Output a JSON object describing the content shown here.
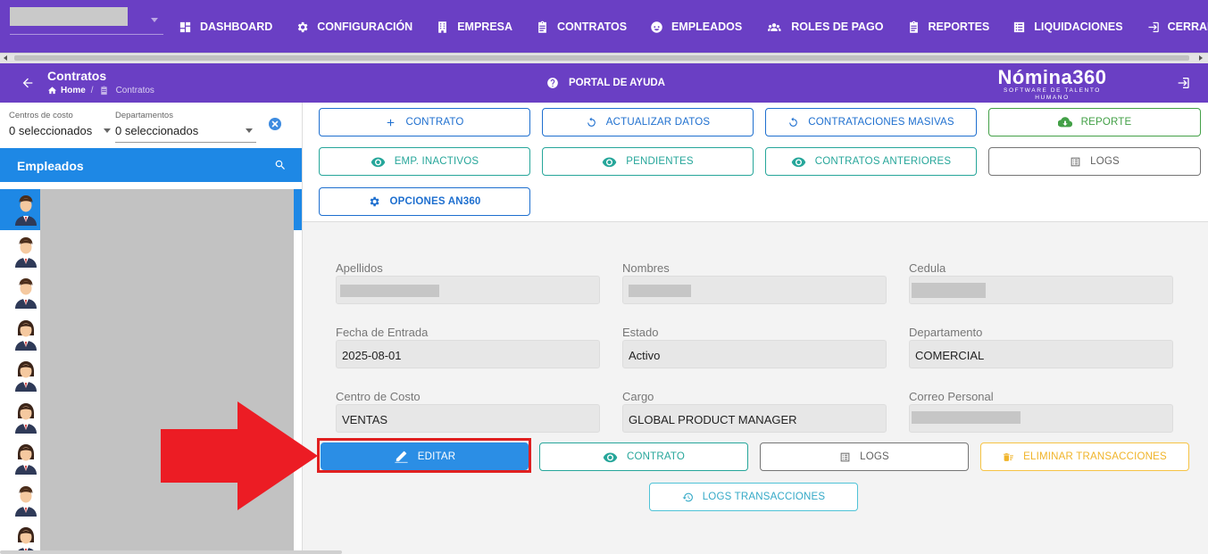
{
  "topnav": {
    "items": [
      {
        "label": "DASHBOARD",
        "icon": "dashboard-icon"
      },
      {
        "label": "CONFIGURACIÓN",
        "icon": "gear-icon"
      },
      {
        "label": "EMPRESA",
        "icon": "building-icon"
      },
      {
        "label": "CONTRATOS",
        "icon": "clipboard-icon"
      },
      {
        "label": "EMPLEADOS",
        "icon": "face-icon"
      },
      {
        "label": "ROLES DE PAGO",
        "icon": "users-icon"
      },
      {
        "label": "REPORTES",
        "icon": "clipboard-icon"
      },
      {
        "label": "LIQUIDACIONES",
        "icon": "list-icon"
      },
      {
        "label": "CERRAR SESIÓN",
        "icon": "logout-icon"
      }
    ]
  },
  "subheader": {
    "title": "Contratos",
    "breadcrumb_home": "Home",
    "breadcrumb_current": "Contratos",
    "help_label": "PORTAL DE AYUDA",
    "brand_main": "Nómina360",
    "brand_sub": "SOFTWARE DE TALENTO HUMANO"
  },
  "filters": {
    "cost_center_label": "Centros de costo",
    "cost_center_value": "0 seleccionados",
    "department_label": "Departamentos",
    "department_value": "0 seleccionados"
  },
  "employees": {
    "title": "Empleados",
    "avatars": [
      "male",
      "male",
      "male",
      "female",
      "female",
      "female",
      "female",
      "male",
      "female"
    ]
  },
  "toolbar": {
    "contrato": "CONTRATO",
    "actualizar": "ACTUALIZAR DATOS",
    "masivas": "CONTRATACIONES MASIVAS",
    "reporte": "REPORTE",
    "inactivos": "EMP. INACTIVOS",
    "pendientes": "PENDIENTES",
    "anteriores": "CONTRATOS ANTERIORES",
    "logs": "LOGS",
    "opciones": "OPCIONES AN360"
  },
  "form": {
    "apellidos_label": "Apellidos",
    "nombres_label": "Nombres",
    "cedula_label": "Cedula",
    "fecha_label": "Fecha de Entrada",
    "fecha_value": "2025-08-01",
    "estado_label": "Estado",
    "estado_value": "Activo",
    "departamento_label": "Departamento",
    "departamento_value": "COMERCIAL",
    "centro_label": "Centro de Costo",
    "centro_value": "VENTAS",
    "cargo_label": "Cargo",
    "cargo_value": "GLOBAL PRODUCT MANAGER",
    "correo_label": "Correo Personal"
  },
  "actions": {
    "editar": "EDITAR",
    "contrato": "CONTRATO",
    "logs": "LOGS",
    "eliminar": "ELIMINAR TRANSACCIONES",
    "logs_trans": "LOGS TRANSACCIONES"
  },
  "colors": {
    "brand_purple": "#6a3fc4",
    "primary_blue": "#1e88e5",
    "highlight_red": "#e02020"
  }
}
